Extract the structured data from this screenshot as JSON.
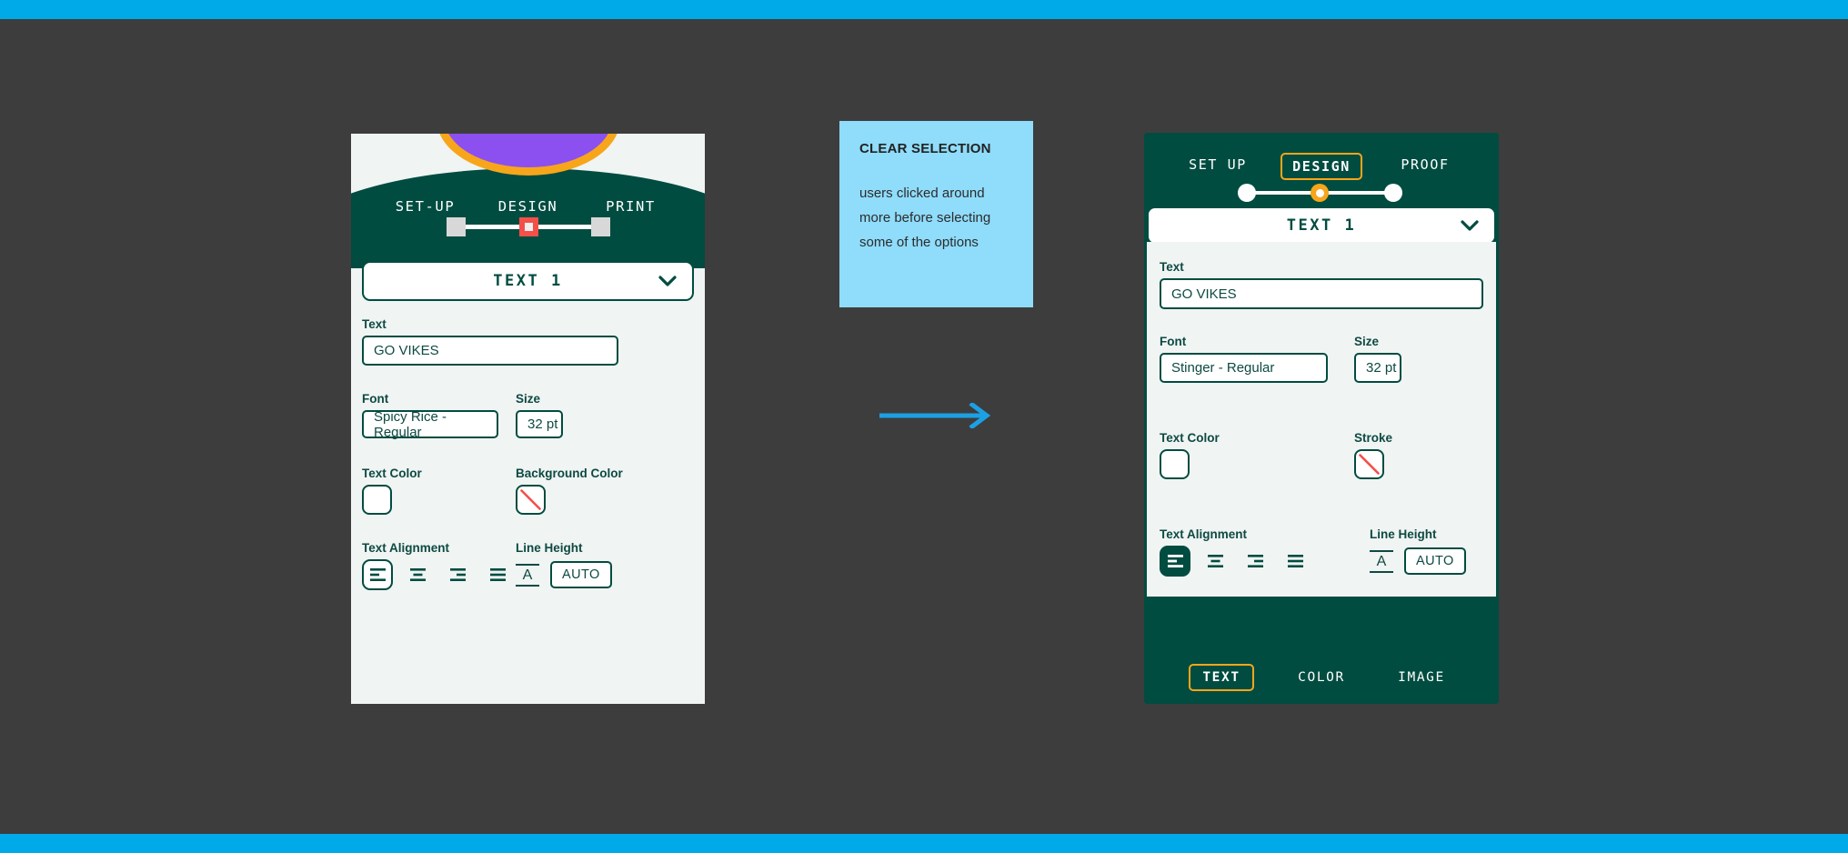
{
  "page": {
    "background_color": "#3d3d3d",
    "accent_bar_color": "#00a9e7",
    "brand_green": "#004c40",
    "brand_orange": "#f7a61b",
    "brand_red": "#f4504a",
    "panel_bg": "#f0f4f3",
    "sticky_color": "#8fdcfb",
    "arrow_color": "#1ca0e3"
  },
  "before_panel": {
    "steps": [
      {
        "label": "SET-UP",
        "state": "inactive"
      },
      {
        "label": "DESIGN",
        "state": "active"
      },
      {
        "label": "PRINT",
        "state": "inactive"
      }
    ],
    "section_title": "TEXT 1",
    "chevron_icon": "chevron-down-icon",
    "fields": {
      "text_label": "Text",
      "text_value": "GO VIKES",
      "font_label": "Font",
      "font_value": "Spicy Rice - Regular",
      "size_label": "Size",
      "size_value": "32 pt",
      "text_color_label": "Text Color",
      "text_color_value": "#ffffff",
      "secondary_color_label": "Background Color",
      "secondary_color_value": "none",
      "alignment_label": "Text Alignment",
      "alignment_selected": "left",
      "alignment_options": [
        "left",
        "center",
        "right",
        "justify"
      ],
      "line_height_label": "Line Height",
      "line_height_value": "AUTO",
      "line_height_icon": "line-height-a-icon"
    }
  },
  "after_panel": {
    "steps": [
      {
        "label": "SET UP",
        "state": "inactive"
      },
      {
        "label": "DESIGN",
        "state": "active"
      },
      {
        "label": "PROOF",
        "state": "inactive"
      }
    ],
    "section_title": "TEXT 1",
    "chevron_icon": "chevron-down-icon",
    "fields": {
      "text_label": "Text",
      "text_value": "GO VIKES",
      "font_label": "Font",
      "font_value": "Stinger - Regular",
      "size_label": "Size",
      "size_value": "32 pt",
      "text_color_label": "Text Color",
      "text_color_value": "#ffffff",
      "secondary_color_label": "Stroke",
      "secondary_color_value": "none",
      "alignment_label": "Text Alignment",
      "alignment_selected": "left",
      "alignment_options": [
        "left",
        "center",
        "right",
        "justify"
      ],
      "line_height_label": "Line Height",
      "line_height_value": "AUTO",
      "line_height_icon": "line-height-a-icon"
    },
    "bottom_tabs": [
      {
        "label": "TEXT",
        "state": "active"
      },
      {
        "label": "COLOR",
        "state": "inactive"
      },
      {
        "label": "IMAGE",
        "state": "inactive"
      }
    ]
  },
  "sticky_note": {
    "title": "CLEAR SELECTION",
    "body": "users clicked around more before selecting some of the options"
  },
  "arrow": {
    "name": "right-arrow-icon",
    "direction": "right"
  }
}
